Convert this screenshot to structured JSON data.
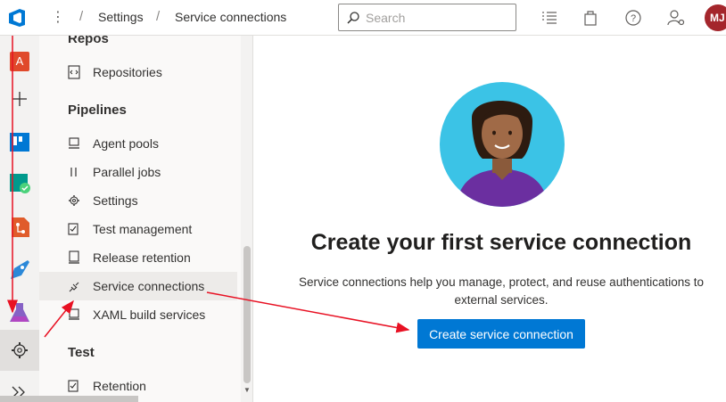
{
  "topbar": {
    "breadcrumb": [
      "Settings",
      "Service connections"
    ],
    "search_placeholder": "Search",
    "avatar_initials": "MJ",
    "icons": [
      "azure-devops-logo-icon",
      "more-icon",
      "search-icon",
      "list-icon",
      "bag-icon",
      "help-icon",
      "user-settings-icon"
    ]
  },
  "rail": {
    "project_initial": "A",
    "project_color": "#e0492b",
    "items": [
      "project-icon",
      "add-icon",
      "boards-icon",
      "test-plans-icon",
      "repos-icon",
      "pipelines-icon",
      "artifacts-icon",
      "settings-icon",
      "expand-icon"
    ]
  },
  "nav": {
    "sections": [
      {
        "header": "Repos",
        "items": [
          {
            "label": "Repositories",
            "icon": "repo-icon"
          }
        ]
      },
      {
        "header": "Pipelines",
        "items": [
          {
            "label": "Agent pools",
            "icon": "agent-pool-icon"
          },
          {
            "label": "Parallel jobs",
            "icon": "parallel-icon"
          },
          {
            "label": "Settings",
            "icon": "gear-icon"
          },
          {
            "label": "Test management",
            "icon": "test-management-icon"
          },
          {
            "label": "Release retention",
            "icon": "retention-icon"
          },
          {
            "label": "Service connections",
            "icon": "plug-icon",
            "selected": true
          },
          {
            "label": "XAML build services",
            "icon": "xaml-icon"
          }
        ]
      },
      {
        "header": "Test",
        "items": [
          {
            "label": "Retention",
            "icon": "retention-icon"
          }
        ]
      }
    ]
  },
  "main": {
    "title": "Create your first service connection",
    "description": "Service connections help you manage, protect, and reuse authentications to external services.",
    "button_label": "Create service connection"
  },
  "colors": {
    "primary": "#0078d4",
    "annotation": "#e81123",
    "avatar": "#a4262c",
    "hero_circle": "#3bc3e6"
  }
}
